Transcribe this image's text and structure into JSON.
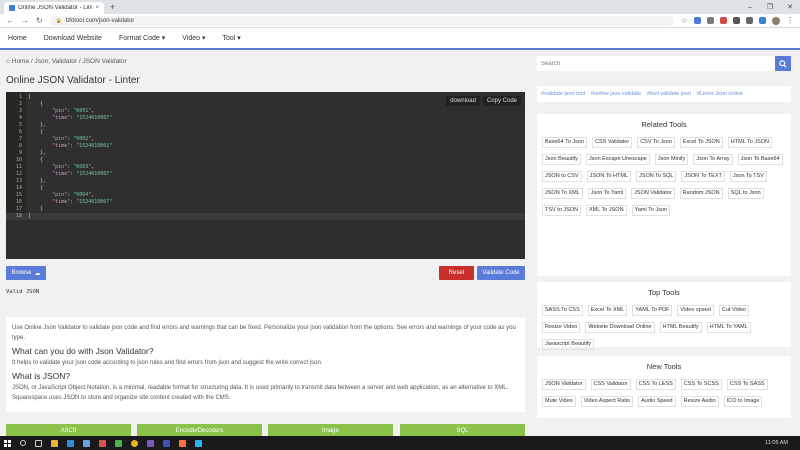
{
  "browser": {
    "tab_title": "Online JSON Validator - Linter",
    "url": "bfotool.com/json-validator",
    "new_tab": "+",
    "tab_close": "×",
    "min": "–",
    "max": "❐",
    "close": "✕"
  },
  "site_nav": {
    "items": [
      "Home",
      "Download Website",
      "Format Code ▾",
      "Video ▾",
      "Tool ▾"
    ]
  },
  "breadcrumb": {
    "home": "Home",
    "sep1": " / ",
    "section": "Json, Validator",
    "sep2": " / ",
    "current": "JSON Validator"
  },
  "page_title": "Online JSON Validator - Linter",
  "editor": {
    "download_label": "download",
    "copy_label": "Copy Code",
    "lines": [
      {
        "n": "1",
        "t": "["
      },
      {
        "n": "2",
        "t": "    {"
      },
      {
        "n": "3",
        "k": "        \"pin\"",
        "v": "\"0001\"",
        "end": ","
      },
      {
        "n": "4",
        "k": "        \"time\"",
        "v": "\"1524010007\"",
        "end": ""
      },
      {
        "n": "5",
        "t": "    },"
      },
      {
        "n": "6",
        "t": "    {"
      },
      {
        "n": "7",
        "k": "        \"pin\"",
        "v": "\"0002\"",
        "end": ","
      },
      {
        "n": "8",
        "k": "        \"time\"",
        "v": "\"1524010002\"",
        "end": ""
      },
      {
        "n": "9",
        "t": "    },"
      },
      {
        "n": "10",
        "t": "    {"
      },
      {
        "n": "11",
        "k": "        \"pin\"",
        "v": "\"0003\"",
        "end": ","
      },
      {
        "n": "12",
        "k": "        \"time\"",
        "v": "\"1524010007\"",
        "end": ""
      },
      {
        "n": "13",
        "t": "    },"
      },
      {
        "n": "14",
        "t": "    {"
      },
      {
        "n": "15",
        "k": "        \"pin\"",
        "v": "\"0004\"",
        "end": ","
      },
      {
        "n": "16",
        "k": "        \"time\"",
        "v": "\"1524010007\"",
        "end": ""
      },
      {
        "n": "17",
        "t": "    }"
      },
      {
        "n": "18",
        "t": "]"
      }
    ]
  },
  "buttons": {
    "browse": "Browse",
    "reset": "Reset",
    "validate": "Validate Code"
  },
  "result_text": "Valid JSON",
  "info": {
    "intro": "Use Online Json Validator to validate json code and find errors and warnings that can be fixed. Personalize your json validation from the options. See errors and warnings of your code as you type.",
    "h1": "What can you do with Json Validator?",
    "p1": "It helps to validate your json code according to json rules and find errors from json and suggest the write correct json.",
    "h2": "What is JSON?",
    "p2": "JSON, or JavaScript Object Notation, is a minimal, readable format for structuring data. It is used primarily to transmit data between a server and web application, as an alternative to XML. Squarespace uses JSON to store and organize site content created with the CMS."
  },
  "bottom_buttons": [
    "ASCII",
    "Encode/Decoders",
    "Image",
    "SQL"
  ],
  "sidebar": {
    "search_placeholder": "Search",
    "tags": [
      "#validate json tool",
      "#online json validate",
      "#tool validate json",
      "#Linter Json online"
    ],
    "related": {
      "title": "Related Tools",
      "items": [
        "Base64 To Json",
        "CSS Validator",
        "CSV To Json",
        "Excel To JSON",
        "HTML To JSON",
        "Json Beautify",
        "Json Escape Unescape",
        "Json Minify",
        "Json To Array",
        "Json To Base64",
        "JSON to CSV",
        "JSON To HTML",
        "JSON To SQL",
        "JSON To TEXT",
        "Json To TSV",
        "JSON To XML",
        "Json To Yaml",
        "JSON Validator",
        "Random JSON",
        "SQL to Json",
        "TSV to JSON",
        "XML To JSON",
        "Yaml To Json"
      ]
    },
    "top": {
      "title": "Top Tools",
      "items": [
        "SASS To CSS",
        "Excel To XML",
        "YAML To PDF",
        "Video speed",
        "Cut Video",
        "Resize Video",
        "Website Download Online",
        "HTML Beautify",
        "HTML To YAML",
        "Javascript Beautify"
      ]
    },
    "new": {
      "title": "New Tools",
      "items": [
        "JSON Validator",
        "CSS Validator",
        "CSS To LESS",
        "CSS To SCSS",
        "CSS To SASS",
        "Mute Video",
        "Video Aspect Ratio",
        "Audio Speed",
        "Resize Audio",
        "ICO to Image"
      ]
    }
  },
  "taskbar": {
    "clock": "11:05 AM"
  },
  "colors": {
    "accent": "#5b7bd8",
    "danger": "#c9302c",
    "green": "#8bc34a",
    "editor_bg": "#2d2d2d"
  }
}
